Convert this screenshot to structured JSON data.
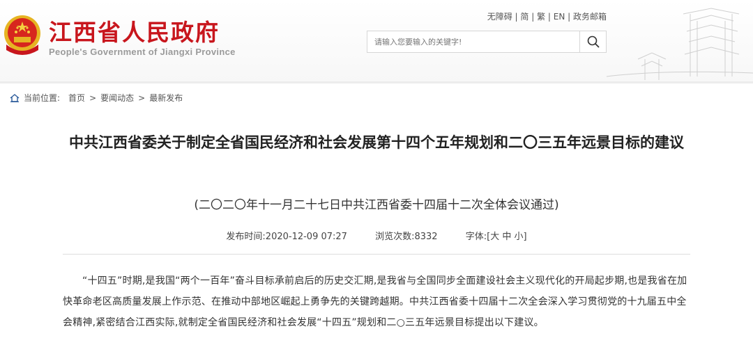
{
  "header": {
    "site_name_cn": "江西省人民政府",
    "site_name_en": "People's Government of Jiangxi Province",
    "top_links": [
      "无障碍",
      "简",
      "繁",
      "EN",
      "政务邮箱"
    ],
    "search": {
      "placeholder": "请输入您要输入的关键字!"
    }
  },
  "breadcrumb": {
    "label": "当前位置:",
    "items": [
      "首页",
      "要闻动态",
      "最新发布"
    ],
    "separator": ">"
  },
  "article": {
    "title": "中共江西省委关于制定全省国民经济和社会发展第十四个五年规划和二〇三五年远景目标的建议",
    "subtitle": "(二〇二〇年十一月二十七日中共江西省委十四届十二次全体会议通过)",
    "publish_label": "发布时间:",
    "publish_time": "2020-12-09 07:27",
    "views_label": "浏览次数:",
    "views": "8332",
    "font_label": "字体:",
    "font_sizes": [
      "大",
      "中",
      "小"
    ],
    "paragraph": "“十四五”时期,是我国“两个一百年”奋斗目标承前启后的历史交汇期,是我省与全国同步全面建设社会主义现代化的开局起步期,也是我省在加快革命老区高质量发展上作示范、在推动中部地区崛起上勇争先的关键跨越期。中共江西省委十四届十二次全会深入学习贯彻党的十九届五中全会精神,紧密结合江西实际,就制定全省国民经济和社会发展“十四五”规划和二○三五年远景目标提出以下建议。"
  },
  "colors": {
    "brand_red": "#c8161d",
    "gold": "#e6b422"
  }
}
